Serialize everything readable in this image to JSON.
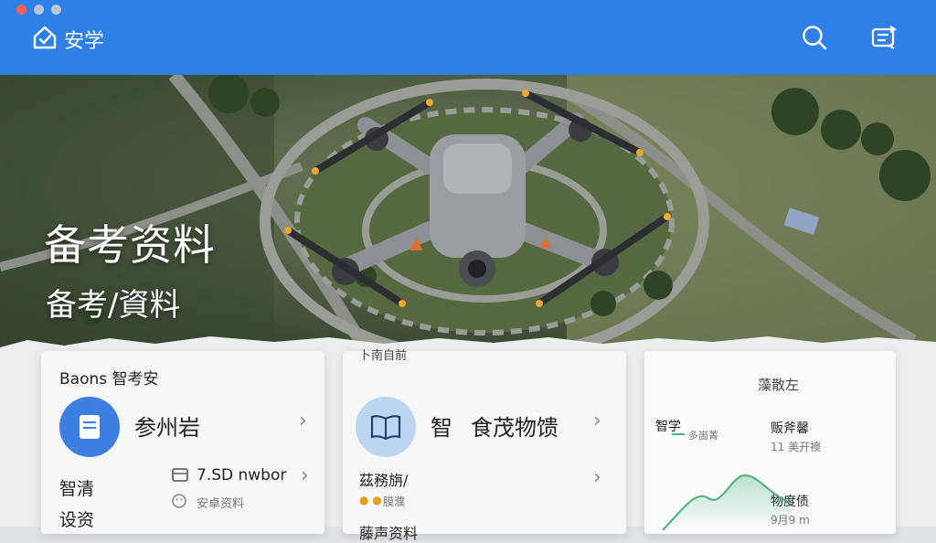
{
  "window": {
    "dots": [
      "#ff5f57",
      "#c0c4cc",
      "#c0c4cc"
    ]
  },
  "header": {
    "brand": "安学",
    "home_icon": "home-check-icon",
    "search_icon": "search-icon",
    "menu_icon": "switch-icon"
  },
  "hero": {
    "title": "备考资料",
    "subtitle": "备考/資料"
  },
  "card1": {
    "title": "Baons 智考安",
    "item1_label": "参州岩",
    "item2_label": "7.SD nwbor",
    "item2_sub": "安卓资料",
    "side_label1": "智清",
    "side_label2": "设资",
    "icon_primary": "document-icon",
    "icon_secondary": "folder-icon",
    "icon_small": "face-icon"
  },
  "card2": {
    "top_label": "卜南自前",
    "item1_prefix": "智",
    "item1_label": "食茂物馈",
    "item2_label": "茲務旃/",
    "item2_sub": "膜濮",
    "item3_label": "藤声资料",
    "icon": "book-icon"
  },
  "card3": {
    "title": "藻散左",
    "legend_a": "智学",
    "legend_a_sub": "多崮菁",
    "stat1_label": "贩斧馨",
    "stat1_value": "11 美开襖",
    "stat2_label": "物度债",
    "stat2_value": "9月9 m",
    "line_color": "#4caf7d"
  }
}
